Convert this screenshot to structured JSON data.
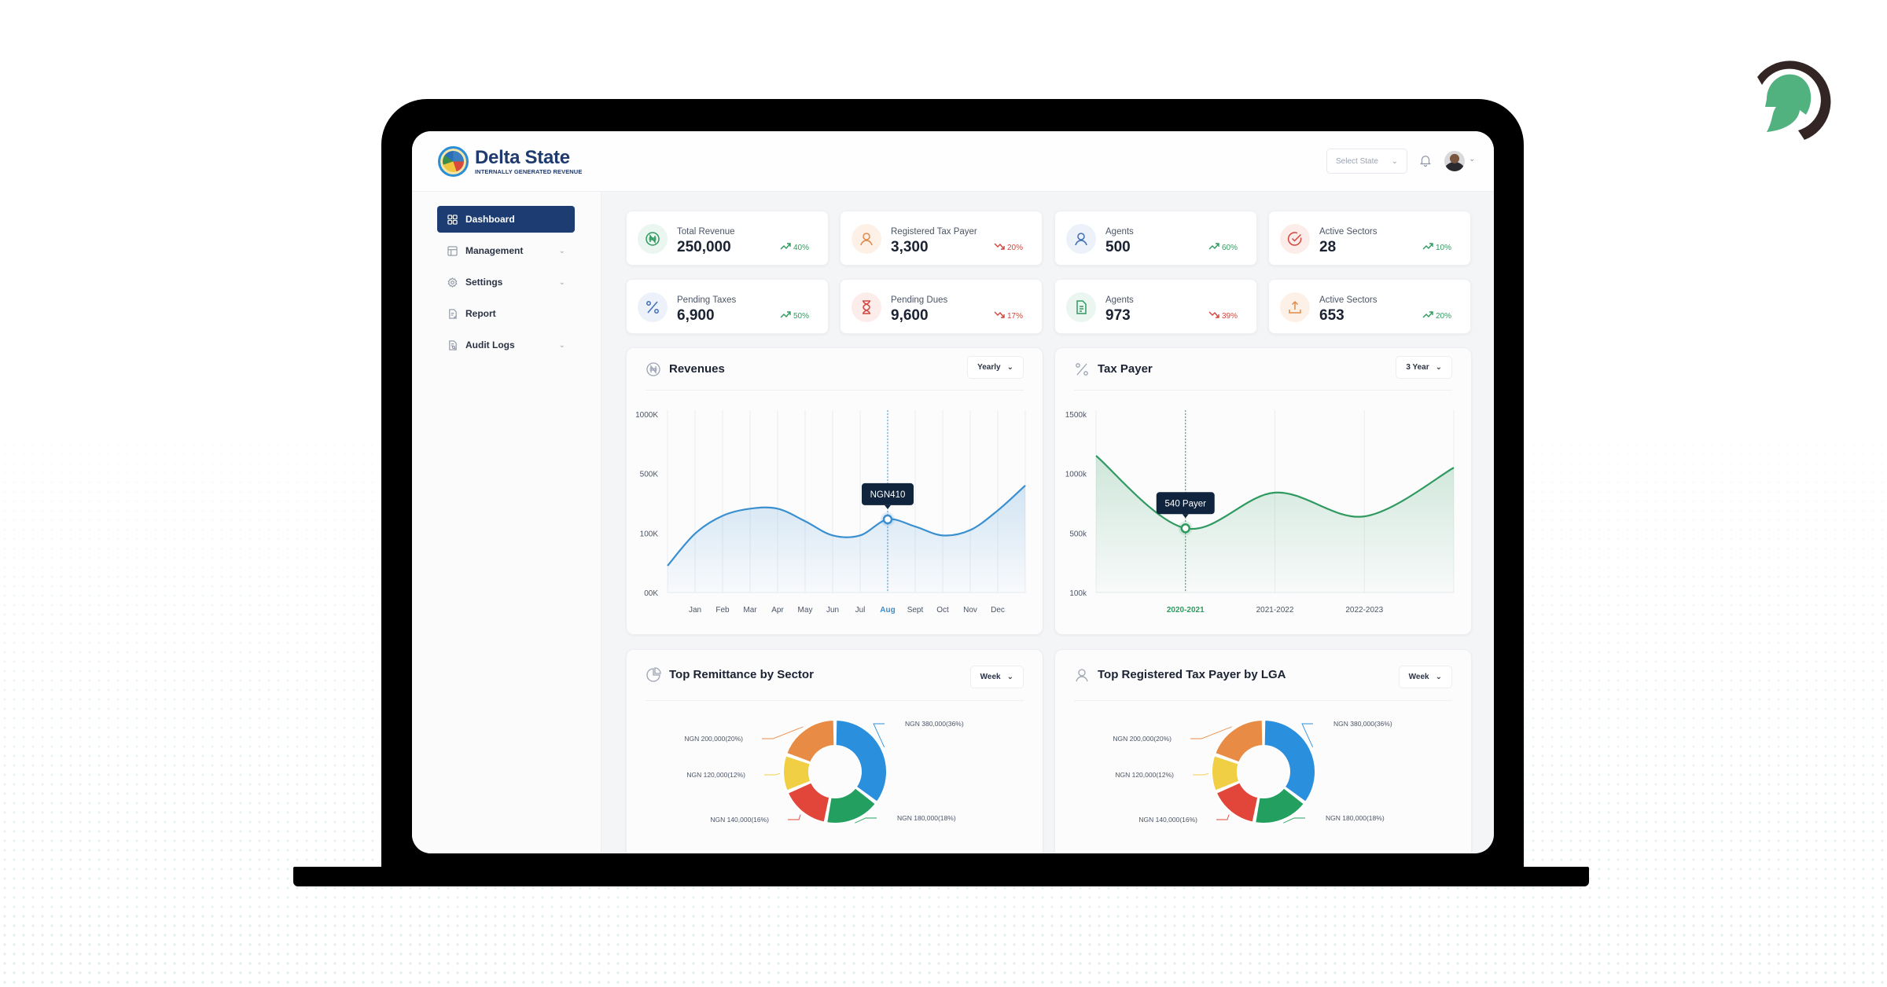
{
  "app": {
    "title": "Delta State",
    "subtitle": "INTERNALLY GENERATED REVENUE"
  },
  "header": {
    "select_state_placeholder": "Select State",
    "icons": [
      "bell-icon",
      "avatar",
      "chevron-down-icon"
    ]
  },
  "sidebar": {
    "items": [
      {
        "label": "Dashboard",
        "icon": "grid-icon",
        "active": true,
        "expandable": false
      },
      {
        "label": "Management",
        "icon": "table-icon",
        "active": false,
        "expandable": true
      },
      {
        "label": "Settings",
        "icon": "gear-icon",
        "active": false,
        "expandable": true
      },
      {
        "label": "Report",
        "icon": "report-icon",
        "active": false,
        "expandable": false
      },
      {
        "label": "Audit Logs",
        "icon": "audit-icon",
        "active": false,
        "expandable": true
      }
    ]
  },
  "stats": [
    {
      "label": "Total Revenue",
      "value": "250,000",
      "trend": "40%",
      "direction": "up",
      "icon": "naira-icon",
      "color": "#2f9a5f",
      "bg": "#eaf6ef"
    },
    {
      "label": "Registered Tax Payer",
      "value": "3,300",
      "trend": "20%",
      "direction": "down",
      "icon": "user-icon",
      "color": "#e08a4a",
      "bg": "#fdf1e7"
    },
    {
      "label": "Agents",
      "value": "500",
      "trend": "60%",
      "direction": "up",
      "icon": "user-icon",
      "color": "#3f6fb5",
      "bg": "#ecf1fa"
    },
    {
      "label": "Active Sectors",
      "value": "28",
      "trend": "10%",
      "direction": "up",
      "icon": "check-circle-icon",
      "color": "#d2453d",
      "bg": "#fcecea"
    },
    {
      "label": "Pending Taxes",
      "value": "6,900",
      "trend": "50%",
      "direction": "up",
      "icon": "percent-icon",
      "color": "#3f6fb5",
      "bg": "#ecf1fa"
    },
    {
      "label": "Pending Dues",
      "value": "9,600",
      "trend": "17%",
      "direction": "down",
      "icon": "hourglass-icon",
      "color": "#d2453d",
      "bg": "#fcecea"
    },
    {
      "label": "Agents",
      "value": "973",
      "trend": "39%",
      "direction": "down",
      "icon": "document-icon",
      "color": "#2f9a5f",
      "bg": "#eaf6ef"
    },
    {
      "label": "Active Sectors",
      "value": "653",
      "trend": "20%",
      "direction": "up",
      "icon": "upload-icon",
      "color": "#e08a4a",
      "bg": "#fdf1e7"
    }
  ],
  "panels": {
    "revenues": {
      "title": "Revenues",
      "dropdown": "Yearly"
    },
    "taxpayer": {
      "title": "Tax Payer",
      "dropdown": "3 Year"
    },
    "remittance": {
      "title": "Top Remittance by Sector",
      "dropdown": "Week"
    },
    "lga": {
      "title": "Top Registered Tax Payer by LGA",
      "dropdown": "Week"
    }
  },
  "chart_data": [
    {
      "type": "area",
      "title": "Revenues",
      "categories": [
        "Jan",
        "Feb",
        "Mar",
        "Apr",
        "May",
        "Jun",
        "Jul",
        "Aug",
        "Sept",
        "Oct",
        "Nov",
        "Dec"
      ],
      "y_ticks": [
        "1000K",
        "500K",
        "100K",
        "00K"
      ],
      "values": [
        330,
        430,
        470,
        470,
        400,
        320,
        320,
        410,
        370,
        320,
        350,
        460
      ],
      "start_value": 150,
      "end_value": 600,
      "highlight": {
        "category": "Aug",
        "label": "NGN410"
      },
      "color": "#3a8fcf",
      "grid": true
    },
    {
      "type": "area",
      "title": "Tax Payer",
      "categories": [
        "2020-2021",
        "2021-2022",
        "2022-2023"
      ],
      "y_ticks": [
        "1500k",
        "1000k",
        "500k",
        "100k"
      ],
      "values": [
        540,
        840,
        640
      ],
      "start_value": 1150,
      "end_value": 1050,
      "highlight": {
        "category": "2020-2021",
        "label": "540 Payer"
      },
      "color": "#2f9a5f",
      "grid": true
    },
    {
      "type": "pie",
      "title": "Top Remittance by Sector",
      "slices": [
        {
          "label": "NGN 380,000(36%)",
          "value": 36,
          "color": "#2a8fdc"
        },
        {
          "label": "NGN 180,000(18%)",
          "value": 18,
          "color": "#23a060"
        },
        {
          "label": "NGN 140,000(16%)",
          "value": 16,
          "color": "#e2463a"
        },
        {
          "label": "NGN 120,000(12%)",
          "value": 12,
          "color": "#f0cf45"
        },
        {
          "label": "NGN 200,000(20%)",
          "value": 20,
          "color": "#e88c45"
        }
      ]
    },
    {
      "type": "pie",
      "title": "Top Registered Tax Payer by LGA",
      "slices": [
        {
          "label": "NGN 380,000(36%)",
          "value": 36,
          "color": "#2a8fdc"
        },
        {
          "label": "NGN 180,000(18%)",
          "value": 18,
          "color": "#23a060"
        },
        {
          "label": "NGN 140,000(16%)",
          "value": 16,
          "color": "#e2463a"
        },
        {
          "label": "NGN 120,000(12%)",
          "value": 12,
          "color": "#f0cf45"
        },
        {
          "label": "NGN 200,000(20%)",
          "value": 20,
          "color": "#e88c45"
        }
      ]
    }
  ]
}
